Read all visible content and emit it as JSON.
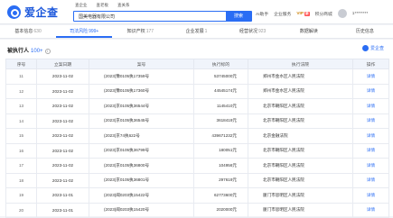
{
  "header": {
    "logo_text": "爱企查",
    "search_tabs": [
      "查企业",
      "查老板",
      "查关系"
    ],
    "search_value": "国美电器有限公司",
    "search_button": "搜索",
    "nav": {
      "item1": "AI助手",
      "item2": "企业服务",
      "vip": "VIP",
      "new_badge": "新",
      "points": "积分商城",
      "user": "1********"
    }
  },
  "tabs": [
    {
      "label": "基本信息",
      "count": "630"
    },
    {
      "label": "司法风险",
      "count": "999+"
    },
    {
      "label": "知识产权",
      "count": "177"
    },
    {
      "label": "企业发展",
      "count": "1"
    },
    {
      "label": "经营状况",
      "count": "923"
    },
    {
      "label": "数据解读",
      "count": ""
    },
    {
      "label": "历史信息",
      "count": ""
    }
  ],
  "section": {
    "title": "被执行人",
    "count": "100+",
    "brand": "爱企查"
  },
  "table": {
    "headers": [
      "序号",
      "立案日期",
      "案号",
      "执行标的",
      "执行法院",
      "操作"
    ],
    "rows": [
      {
        "idx": "11",
        "date": "2023-11-02",
        "case": "(2023)豫0105执17359号",
        "amount": "53745000元",
        "court": "郑州市金水区人民法院",
        "action": "详情"
      },
      {
        "idx": "12",
        "date": "2023-11-02",
        "case": "(2023)豫0105执17360号",
        "amount": "44545174元",
        "court": "郑州市金水区人民法院",
        "action": "详情"
      },
      {
        "idx": "13",
        "date": "2023-11-02",
        "case": "(2023)京0105执36544号",
        "amount": "1145410元",
        "court": "北京市朝阳区人民法院",
        "action": "详情"
      },
      {
        "idx": "14",
        "date": "2023-11-02",
        "case": "(2023)京0105执36545号",
        "amount": "3618419元",
        "court": "北京市朝阳区人民法院",
        "action": "详情"
      },
      {
        "idx": "15",
        "date": "2023-11-02",
        "case": "(2023)京74执622号",
        "amount": "439671232元",
        "court": "北京金融法院",
        "action": "详情"
      },
      {
        "idx": "16",
        "date": "2023-11-02",
        "case": "(2023)京0105执36799号",
        "amount": "180051元",
        "court": "北京市朝阳区人民法院",
        "action": "详情"
      },
      {
        "idx": "17",
        "date": "2023-11-02",
        "case": "(2023)京0105执36800号",
        "amount": "104956元",
        "court": "北京市朝阳区人民法院",
        "action": "详情"
      },
      {
        "idx": "18",
        "date": "2023-11-02",
        "case": "(2023)京0105执36801号",
        "amount": "297619元",
        "court": "北京市朝阳区人民法院",
        "action": "详情"
      },
      {
        "idx": "19",
        "date": "2023-11-01",
        "case": "(2023)闽0203执15422号",
        "amount": "62773600元",
        "court": "厦门市思明区人民法院",
        "action": "详情"
      },
      {
        "idx": "20",
        "date": "2023-11-01",
        "case": "(2023)闽0203执15420号",
        "amount": "2020000元",
        "court": "厦门市思明区人民法院",
        "action": "详情"
      }
    ]
  }
}
